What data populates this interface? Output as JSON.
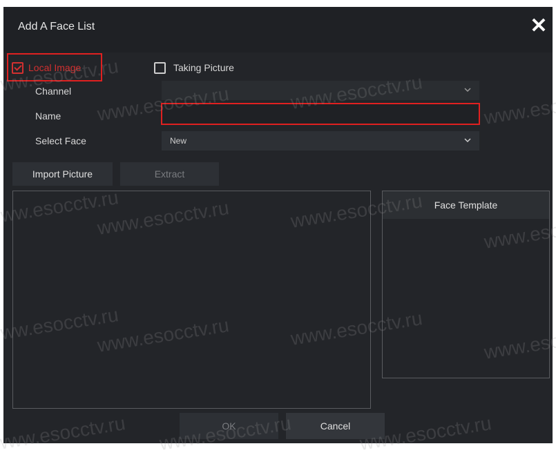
{
  "dialog": {
    "title": "Add A Face List",
    "close_glyph": "✕"
  },
  "source": {
    "local_image": {
      "label": "Local Image",
      "checked": true
    },
    "taking_picture": {
      "label": "Taking Picture",
      "checked": false
    }
  },
  "form": {
    "channel_label": "Channel",
    "channel_value": "",
    "name_label": "Name",
    "name_value": "",
    "select_face_label": "Select Face",
    "select_face_value": "New"
  },
  "actions": {
    "import_picture": "Import Picture",
    "extract": "Extract",
    "ok": "OK",
    "cancel": "Cancel"
  },
  "face_template": {
    "header": "Face Template"
  },
  "watermark": "www.esocctv.ru",
  "colors": {
    "highlight_red": "#e02020",
    "background": "#232529"
  }
}
